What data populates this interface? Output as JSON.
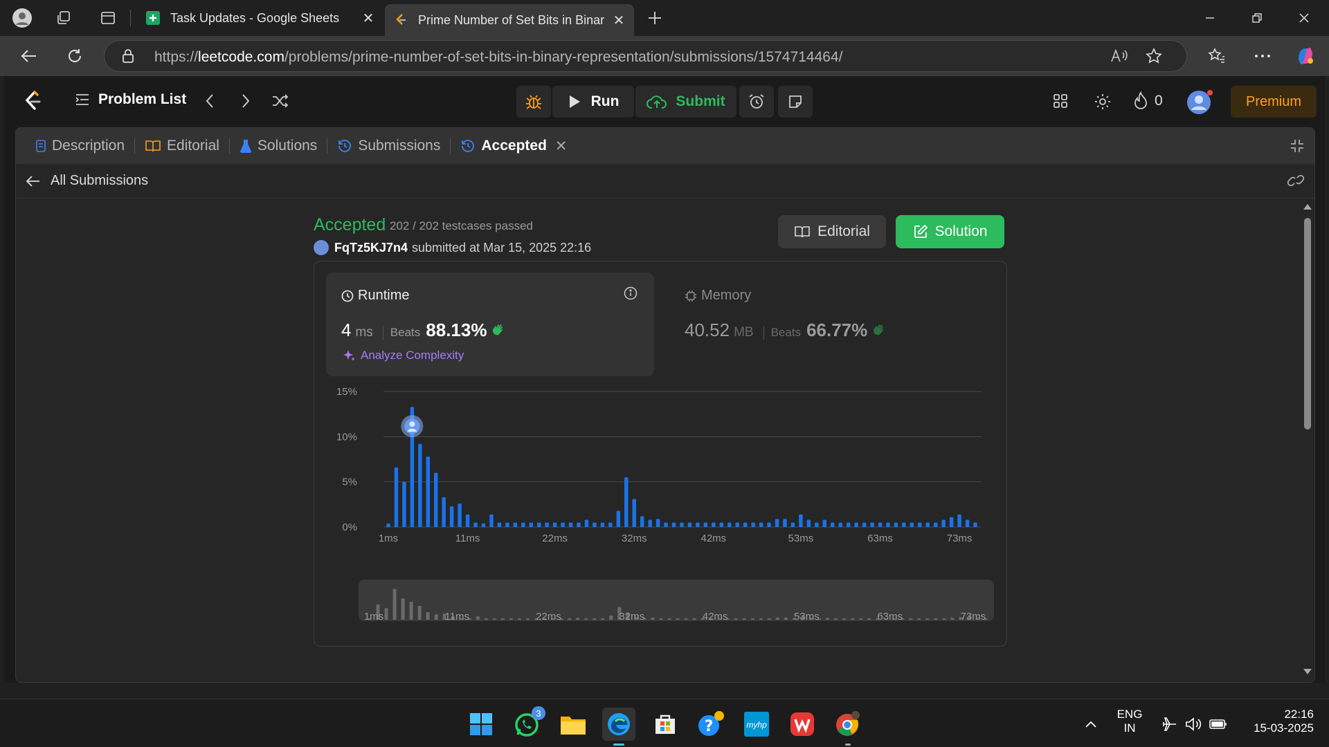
{
  "browser": {
    "tabs": [
      {
        "title": "Task Updates - Google Sheets"
      },
      {
        "title": "Prime Number of Set Bits in Binar"
      }
    ],
    "url_prefix": "https://",
    "url_domain": "leetcode.com",
    "url_path": "/problems/prime-number-of-set-bits-in-binary-representation/submissions/1574714464/"
  },
  "navbar": {
    "problem_list": "Problem List",
    "run": "Run",
    "submit": "Submit",
    "streak": "0",
    "premium": "Premium"
  },
  "panel_tabs": [
    {
      "label": "Description"
    },
    {
      "label": "Editorial"
    },
    {
      "label": "Solutions"
    },
    {
      "label": "Submissions"
    },
    {
      "label": "Accepted"
    }
  ],
  "subhead": {
    "back_label": "All Submissions"
  },
  "submission": {
    "status": "Accepted",
    "testcases": "202 / 202 testcases passed",
    "user": "FqTz5KJ7n4",
    "submitted": "submitted at Mar 15, 2025 22:16",
    "editorial_btn": "Editorial",
    "solution_btn": "Solution"
  },
  "runtime": {
    "title": "Runtime",
    "value": "4",
    "unit": "ms",
    "beats_label": "Beats",
    "beats": "88.13%",
    "analyze": "Analyze Complexity"
  },
  "memory": {
    "title": "Memory",
    "value": "40.52",
    "unit": "MB",
    "beats_label": "Beats",
    "beats": "66.77%"
  },
  "colors": {
    "accent_green": "#2cbb5d",
    "bar_blue": "#1a73e8",
    "premium_orange": "#ffa116",
    "analyze_purple": "#a77cff"
  },
  "chart_data": {
    "type": "bar",
    "title": "",
    "xlabel": "",
    "ylabel": "",
    "ylim": [
      0,
      15
    ],
    "yticks": [
      "15%",
      "10%",
      "5%",
      "0%"
    ],
    "xticks": [
      "1ms",
      "11ms",
      "22ms",
      "32ms",
      "42ms",
      "53ms",
      "63ms",
      "73ms"
    ],
    "x_min": 1,
    "x_max": 75,
    "highlight_x": 4,
    "x": [
      1,
      2,
      3,
      4,
      5,
      6,
      7,
      8,
      9,
      10,
      11,
      12,
      13,
      14,
      15,
      16,
      17,
      18,
      19,
      20,
      21,
      22,
      23,
      24,
      25,
      26,
      27,
      28,
      29,
      30,
      31,
      32,
      33,
      34,
      35,
      36,
      37,
      38,
      39,
      40,
      41,
      42,
      43,
      44,
      45,
      46,
      47,
      48,
      49,
      50,
      51,
      52,
      53,
      54,
      55,
      56,
      57,
      58,
      59,
      60,
      61,
      62,
      63,
      64,
      65,
      66,
      67,
      68,
      69,
      70,
      71,
      72,
      73,
      74,
      75
    ],
    "values": [
      0.4,
      6.6,
      5.0,
      13.3,
      9.2,
      7.8,
      6.0,
      3.3,
      2.3,
      2.6,
      1.4,
      0.5,
      0.4,
      1.4,
      0.5,
      0.5,
      0.5,
      0.5,
      0.5,
      0.5,
      0.5,
      0.5,
      0.5,
      0.5,
      0.5,
      0.8,
      0.5,
      0.5,
      0.5,
      1.8,
      5.5,
      3.1,
      1.2,
      0.8,
      0.9,
      0.5,
      0.5,
      0.5,
      0.5,
      0.5,
      0.5,
      0.5,
      0.5,
      0.5,
      0.5,
      0.5,
      0.5,
      0.5,
      0.5,
      0.9,
      0.9,
      0.5,
      1.4,
      0.8,
      0.5,
      0.8,
      0.5,
      0.5,
      0.5,
      0.5,
      0.5,
      0.5,
      0.5,
      0.5,
      0.5,
      0.5,
      0.5,
      0.5,
      0.5,
      0.5,
      0.8,
      1.1,
      1.4,
      0.8,
      0.5
    ]
  },
  "taskbar": {
    "whatsapp_badge": "3",
    "lang1": "ENG",
    "lang2": "IN",
    "time": "22:16",
    "date": "15-03-2025"
  }
}
